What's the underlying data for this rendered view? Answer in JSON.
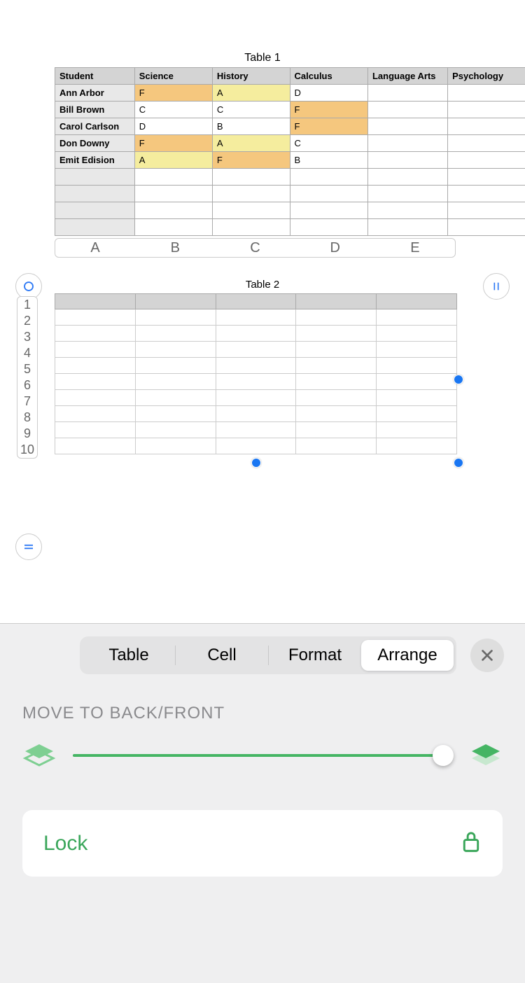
{
  "tables": {
    "t1": {
      "title": "Table 1",
      "headers": [
        "Student",
        "Science",
        "History",
        "Calculus",
        "Language Arts",
        "Psychology"
      ],
      "rows": [
        {
          "cells": [
            "Ann Arbor",
            "F",
            "A",
            "D",
            "",
            ""
          ]
        },
        {
          "cells": [
            "Bill Brown",
            "C",
            "C",
            "F",
            "",
            ""
          ]
        },
        {
          "cells": [
            "Carol Carlson",
            "D",
            "B",
            "F",
            "",
            ""
          ]
        },
        {
          "cells": [
            "Don Downy",
            "F",
            "A",
            "C",
            "",
            ""
          ]
        },
        {
          "cells": [
            "Emit Edision",
            "A",
            "F",
            "B",
            "",
            ""
          ]
        }
      ]
    },
    "t2": {
      "title": "Table 2"
    }
  },
  "cols": {
    "a": "A",
    "b": "B",
    "c": "C",
    "d": "D",
    "e": "E"
  },
  "rows": {
    "r1": "1",
    "r2": "2",
    "r3": "3",
    "r4": "4",
    "r5": "5",
    "r6": "6",
    "r7": "7",
    "r8": "8",
    "r9": "9",
    "r10": "10"
  },
  "inspector": {
    "tabs": {
      "table": "Table",
      "cell": "Cell",
      "format": "Format",
      "arrange": "Arrange"
    },
    "section_label": "MOVE TO BACK/FRONT",
    "lock_label": "Lock"
  }
}
